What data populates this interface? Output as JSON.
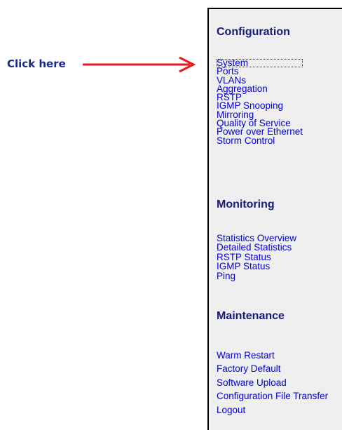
{
  "annotation": {
    "label": "Click here",
    "color": "#e81a1a"
  },
  "colors": {
    "heading": "#16187a",
    "link": "#0000dd",
    "panel_bg": "#efefef",
    "annotation_text": "#1a2a8c"
  },
  "nav": {
    "configuration": {
      "heading": "Configuration",
      "items": [
        "System",
        "Ports",
        "VLANs",
        "Aggregation",
        "RSTP",
        "IGMP Snooping",
        "Mirroring",
        "Quality of Service",
        "Power over Ethernet",
        "Storm Control"
      ]
    },
    "monitoring": {
      "heading": "Monitoring",
      "items": [
        "Statistics Overview",
        "Detailed Statistics",
        "RSTP Status",
        "IGMP Status",
        "Ping"
      ]
    },
    "maintenance": {
      "heading": "Maintenance",
      "items": [
        "Warm Restart",
        "Factory Default",
        "Software Upload",
        "Configuration File Transfer",
        "Logout"
      ]
    }
  }
}
